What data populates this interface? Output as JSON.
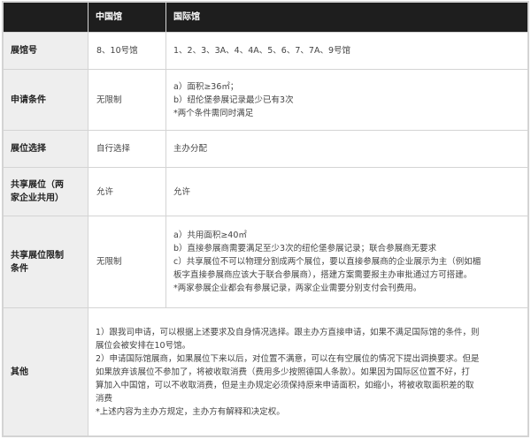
{
  "headers": [
    "",
    "中国馆",
    "国际馆"
  ],
  "rows": [
    {
      "label": "展馆号",
      "china": [
        "8、10号馆"
      ],
      "intl": [
        "1、2、3、3A、4、4A、5、6、7、7A、9号馆"
      ]
    },
    {
      "label": "申请条件",
      "china": [
        "无限制"
      ],
      "intl": [
        "a）面积≥36㎡；",
        "b）纽伦堡参展记录最少已有3次",
        "*两个条件需同时满足"
      ]
    },
    {
      "label": "展位选择",
      "china": [
        "自行选择"
      ],
      "intl": [
        "主办分配"
      ]
    },
    {
      "label_lines": [
        "共享展位（两",
        "家企业共用）"
      ],
      "china": [
        "允许"
      ],
      "intl": [
        "允许"
      ]
    },
    {
      "label_lines": [
        "共享展位限制",
        "条件"
      ],
      "china": [
        "无限制"
      ],
      "intl": [
        "a）共用面积≥40㎡",
        "b）直接参展商需要满足至少3次的纽伦堡参展记录；联合参展商无要求",
        "c）共享展位不可以物理分割成两个展位，要以直接参展商的企业展示为主（例如楣",
        "板字直接参展商应该大于联合参展商），搭建方案需要报主办审批通过方可搭建。",
        "*两家参展企业都会有参展记录，两家企业需要分别支付会刊费用。"
      ]
    },
    {
      "label": "其他",
      "other": [
        "1）跟我司申请，可以根据上述要求及自身情况选择。跟主办方直接申请，如果不满足国际馆的条件，则",
        "展位会被安排在10号馆。",
        "2）申请国际馆展商，如果展位下来以后，对位置不满意，可以在有空展位的情况下提出调换要求。但是",
        "如果放弃该展位不参加了，将被收取消费（费用多少按照德国人条款）。如果因为国际区位置不好，打",
        "算加入中国馆，可以不收取消费，但是主办规定必须保持原来申请面积，如缩小，将被收取面积差的取",
        "消费",
        "*上述内容为主办方规定，主办方有解释和决定权。"
      ]
    }
  ]
}
